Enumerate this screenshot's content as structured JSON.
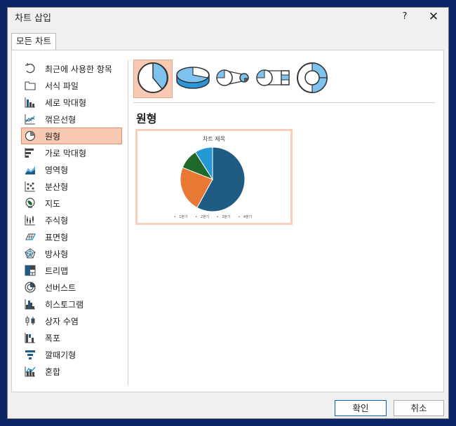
{
  "window": {
    "title": "차트 삽입",
    "help": "?",
    "close": "✕"
  },
  "tabs": [
    {
      "label": "모든 차트"
    }
  ],
  "sidebar": {
    "items": [
      {
        "label": "최근에 사용한 항목",
        "icon": "recent-icon"
      },
      {
        "label": "서식 파일",
        "icon": "template-folder-icon"
      },
      {
        "label": "세로 막대형",
        "icon": "column-chart-icon"
      },
      {
        "label": "꺾은선형",
        "icon": "line-chart-icon"
      },
      {
        "label": "원형",
        "icon": "pie-chart-icon",
        "selected": true
      },
      {
        "label": "가로 막대형",
        "icon": "bar-chart-icon"
      },
      {
        "label": "영역형",
        "icon": "area-chart-icon"
      },
      {
        "label": "분산형",
        "icon": "scatter-chart-icon"
      },
      {
        "label": "지도",
        "icon": "map-chart-icon"
      },
      {
        "label": "주식형",
        "icon": "stock-chart-icon"
      },
      {
        "label": "표면형",
        "icon": "surface-chart-icon"
      },
      {
        "label": "방사형",
        "icon": "radar-chart-icon"
      },
      {
        "label": "트리맵",
        "icon": "treemap-chart-icon"
      },
      {
        "label": "선버스트",
        "icon": "sunburst-chart-icon"
      },
      {
        "label": "히스토그램",
        "icon": "histogram-chart-icon"
      },
      {
        "label": "상자 수염",
        "icon": "box-whisker-chart-icon"
      },
      {
        "label": "폭포",
        "icon": "waterfall-chart-icon"
      },
      {
        "label": "깔때기형",
        "icon": "funnel-chart-icon"
      },
      {
        "label": "혼합",
        "icon": "combo-chart-icon"
      }
    ]
  },
  "subtypes": [
    {
      "icon": "pie-icon",
      "selected": true
    },
    {
      "icon": "3d-pie-icon"
    },
    {
      "icon": "pie-of-pie-icon"
    },
    {
      "icon": "bar-of-pie-icon"
    },
    {
      "icon": "doughnut-icon"
    }
  ],
  "section": {
    "title": "원형"
  },
  "preview": {
    "chart_title": "차트 제목",
    "legend": [
      "1분기",
      "2분기",
      "3분기",
      "4분기"
    ]
  },
  "chart_data": {
    "type": "pie",
    "title": "차트 제목",
    "categories": [
      "1분기",
      "2분기",
      "3분기",
      "4분기"
    ],
    "values": [
      58,
      23,
      10,
      9
    ],
    "colors": [
      "#1f5c84",
      "#e87833",
      "#1f6a2a",
      "#2398d4"
    ]
  },
  "colors": {
    "selected_bg": "#f8c9b3",
    "selected_border": "#e18e67",
    "accent": "#0a5fb3"
  },
  "buttons": {
    "ok": "확인",
    "cancel": "취소"
  }
}
